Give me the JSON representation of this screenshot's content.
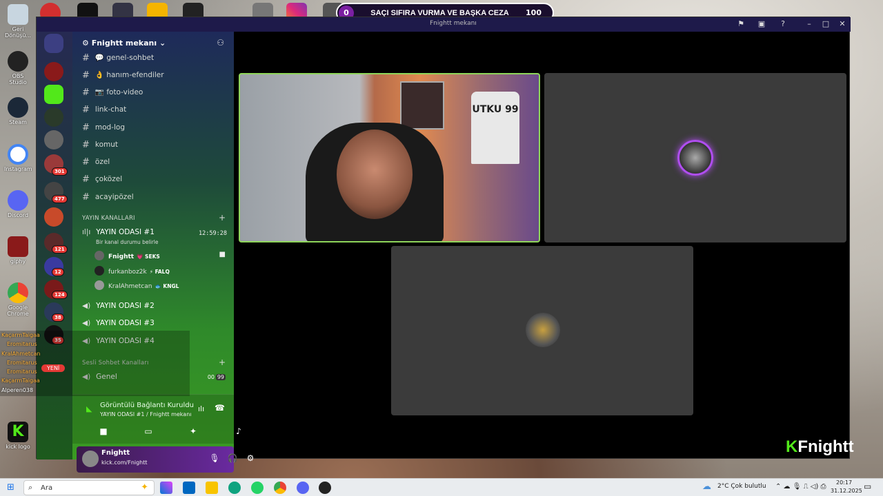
{
  "colors": {
    "accent": "#52e81a",
    "stage_bg": "#000000",
    "tile_bg": "#3b3b3b",
    "banner_border": "#ffffff",
    "badge": "#e53935"
  },
  "desktop": {
    "icons": [
      {
        "label": "Geri Dönüşü...",
        "icon": "recycle-bin-icon"
      },
      {
        "label": "OBS Studio",
        "icon": "obs-icon"
      },
      {
        "label": "Steam",
        "icon": "steam-icon"
      },
      {
        "label": "Instagram",
        "icon": "instagram-icon"
      },
      {
        "label": "Discord",
        "icon": "discord-icon"
      },
      {
        "label": "giphy",
        "icon": "giphy-icon"
      },
      {
        "label": "Google Chrome",
        "icon": "chrome-icon"
      },
      {
        "label": "kick logo",
        "icon": "kick-icon"
      }
    ]
  },
  "banner": {
    "count": "0",
    "text": "SAÇI SIFIRA VURMA VE BAŞKA CEZA",
    "goal": "100"
  },
  "window": {
    "title": "Fnightt mekanı"
  },
  "server": {
    "name": "Fnightt mekanı"
  },
  "channels": [
    {
      "label": "💬 genel-sohbet"
    },
    {
      "label": "👌 hanım-efendiler"
    },
    {
      "label": "📷 foto-video"
    },
    {
      "label": "link-chat"
    },
    {
      "label": "mod-log"
    },
    {
      "label": "komut"
    },
    {
      "label": "özel"
    },
    {
      "label": "çoközel"
    },
    {
      "label": "acayipözel"
    }
  ],
  "categories": {
    "stream": "YAYIN KANALLARI",
    "voice": "Sesli Sohbet Kanalları"
  },
  "voice_channels": {
    "active": {
      "name": "YAYIN ODASI #1",
      "timer": "12:59:28",
      "status": "Bir kanal durumu belirle"
    },
    "users": [
      {
        "name": "Fnightt",
        "tag": "💗 SEKS"
      },
      {
        "name": "furkanboz2k",
        "tag": "⚡ FALQ"
      },
      {
        "name": "KralAhmetcan",
        "tag": "🐟 KNGL"
      }
    ],
    "others": [
      "YAYIN ODASI #2",
      "YAYIN ODASI #3",
      "YAYIN ODASI #4"
    ],
    "genel": {
      "name": "Genel",
      "c1": "00",
      "c2": "99"
    }
  },
  "guild_badges": [
    "301",
    "477",
    "121",
    "12",
    "124",
    "38",
    "35"
  ],
  "rtc": {
    "status": "Görüntülü Bağlantı Kuruldu",
    "sub": "YAYIN ODASI #1 / Fnightt mekanı"
  },
  "user": {
    "name": "Fnightt",
    "status": "kick.com/Fnightt"
  },
  "stage": {
    "shirt_text": "UTKU 99",
    "brand": "Fnightt",
    "brand_k": "K"
  },
  "chat_overlay": {
    "lines": [
      "KaçarmTaigaa",
      "Eromitarus",
      "KralAhmetcan",
      "Eromitarus",
      "Eromitarus",
      "KaçarmTaigaa",
      "Alperen038"
    ],
    "new_label": "YENİ"
  },
  "taskbar": {
    "search_placeholder": "Ara",
    "weather": "2°C  Çok bulutlu",
    "time": "20:17",
    "date": "31.12.2025"
  }
}
